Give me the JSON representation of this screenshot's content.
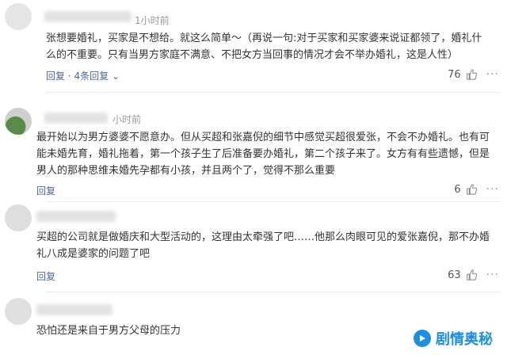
{
  "comments": [
    {
      "time": "1小时前",
      "text": "张想要婚礼，买家是不想给。就这么简单～（再说一句:对于买家和买家婆来说证都领了，婚礼什么的不重要。只有当男方家庭不满意、不把女方当回事的情况才会不举办婚礼，这是人性）",
      "reply_label": "回复",
      "replies_label": "· 4条回复",
      "likes": "76"
    },
    {
      "time": "小时前",
      "text": "最开始以为男方婆婆不愿意办。但从买超和张嘉倪的细节中感觉买超很爱张，不会不办婚礼。也有可能未婚先育，婚礼拖着，第一个孩子生了后准备要办婚礼，第二个孩子来了。女方有有些遗憾，但是男人的那种思维未婚先孕都有小孩，并且两个了，觉得不那么重要",
      "reply_label": "回复",
      "likes": "6"
    },
    {
      "text": "买超的公司就是做婚庆和大型活动的，这理由太牵强了吧……他那么肉眼可见的爱张嘉倪，那不办婚礼八成是婆家的问题了吧",
      "reply_label": "回复",
      "likes": "63"
    },
    {
      "text": "恐怕还是来自于男方父母的压力"
    }
  ],
  "watermark": "剧情奥秘",
  "colors": {
    "link": "#4d6894",
    "watermark": "#1e8fe0"
  }
}
